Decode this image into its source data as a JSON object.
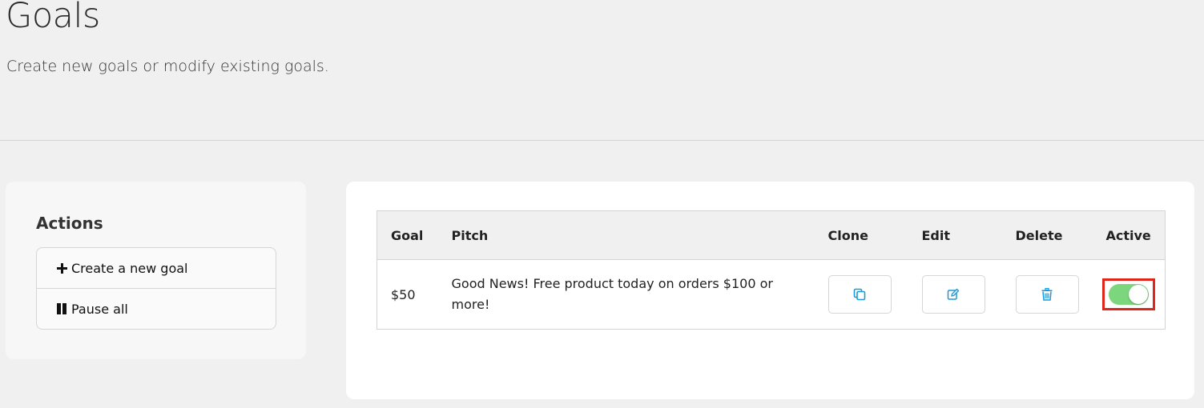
{
  "page": {
    "title": "Goals",
    "subtitle": "Create new goals or modify existing goals."
  },
  "actions": {
    "title": "Actions",
    "items": [
      {
        "label": "Create a new goal",
        "icon": "plus-icon"
      },
      {
        "label": "Pause all",
        "icon": "pause-icon"
      }
    ]
  },
  "table": {
    "headers": {
      "goal": "Goal",
      "pitch": "Pitch",
      "clone": "Clone",
      "edit": "Edit",
      "delete": "Delete",
      "active": "Active"
    },
    "rows": [
      {
        "goal": "$50",
        "pitch": "Good News! Free product today on orders $100 or more!",
        "clone_icon": "copy-icon",
        "edit_icon": "edit-icon",
        "delete_icon": "trash-icon",
        "active": true
      }
    ]
  },
  "colors": {
    "background": "#f0f0f0",
    "card": "#ffffff",
    "icon_accent": "#1a9bd7",
    "toggle_on": "#7bd67e",
    "highlight_border": "#e0261b"
  }
}
